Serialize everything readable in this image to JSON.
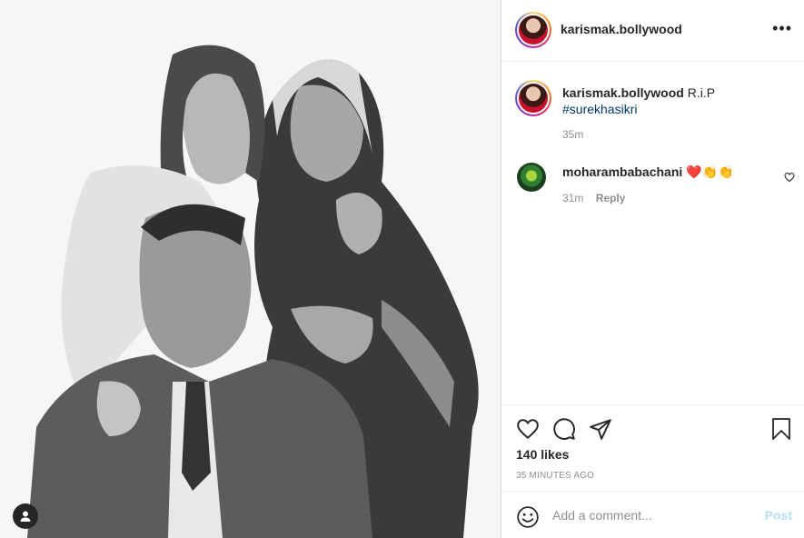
{
  "post": {
    "username": "karismak.bollywood",
    "more_label": "•••",
    "caption": {
      "username": "karismak.bollywood",
      "text": "R.i.P",
      "hashtag": "#surekhasikri",
      "time": "35m"
    },
    "comments": [
      {
        "username": "moharambabachani",
        "text": "❤️👏👏",
        "time": "31m",
        "reply_label": "Reply"
      }
    ],
    "likes": "140 likes",
    "time_ago": "35 MINUTES AGO",
    "add_comment_placeholder": "Add a comment...",
    "post_label": "Post"
  },
  "icons": {
    "like": "heart-icon",
    "comment": "comment-icon",
    "share": "paper-plane-icon",
    "save": "bookmark-icon",
    "emoji": "smiley-icon",
    "tag": "user-tag-icon"
  },
  "colors": {
    "text": "#262626",
    "secondary": "#8e8e8e",
    "hashtag": "#00376b",
    "post_disabled": "#b2dffc",
    "border": "#dbdbdb"
  }
}
